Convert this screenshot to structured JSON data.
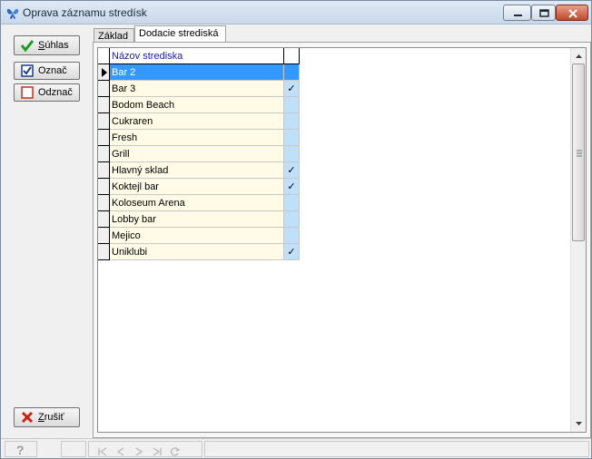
{
  "window": {
    "title": "Oprava záznamu stredísk",
    "controls": {
      "minimize": "minimize",
      "maximize": "maximize",
      "close": "close"
    }
  },
  "buttons": {
    "suhlas": {
      "accel": "S",
      "rest": "úhlas",
      "icon": "check-icon"
    },
    "oznac": {
      "label": "Označ",
      "icon": "checked-box-icon"
    },
    "odznac": {
      "label": "Odznač",
      "icon": "unchecked-box-icon"
    },
    "zrusit": {
      "accel": "Z",
      "rest": "rušiť",
      "icon": "x-icon"
    }
  },
  "tabs": [
    {
      "label": "Základ",
      "active": false
    },
    {
      "label": "Dodacie strediská",
      "active": true
    }
  ],
  "grid": {
    "header": {
      "name": "Názov strediska",
      "check": ""
    },
    "rows": [
      {
        "name": "Bar 2",
        "checked": "",
        "selected": true
      },
      {
        "name": "Bar 3",
        "checked": "✓"
      },
      {
        "name": "Bodom Beach",
        "checked": ""
      },
      {
        "name": "Cukraren",
        "checked": ""
      },
      {
        "name": "Fresh",
        "checked": ""
      },
      {
        "name": " Grill",
        "checked": ""
      },
      {
        "name": "Hlavný sklad",
        "checked": "✓"
      },
      {
        "name": "Koktejl bar",
        "checked": "✓"
      },
      {
        "name": "Koloseum Arena",
        "checked": ""
      },
      {
        "name": "Lobby bar",
        "checked": ""
      },
      {
        "name": "Mejico",
        "checked": ""
      },
      {
        "name": "Uniklubi",
        "checked": "✓"
      }
    ]
  },
  "statusbar": {
    "help_icon": "help-icon",
    "nav": [
      "first-record-icon",
      "prev-record-icon",
      "next-record-icon",
      "last-record-icon",
      "refresh-icon"
    ]
  }
}
